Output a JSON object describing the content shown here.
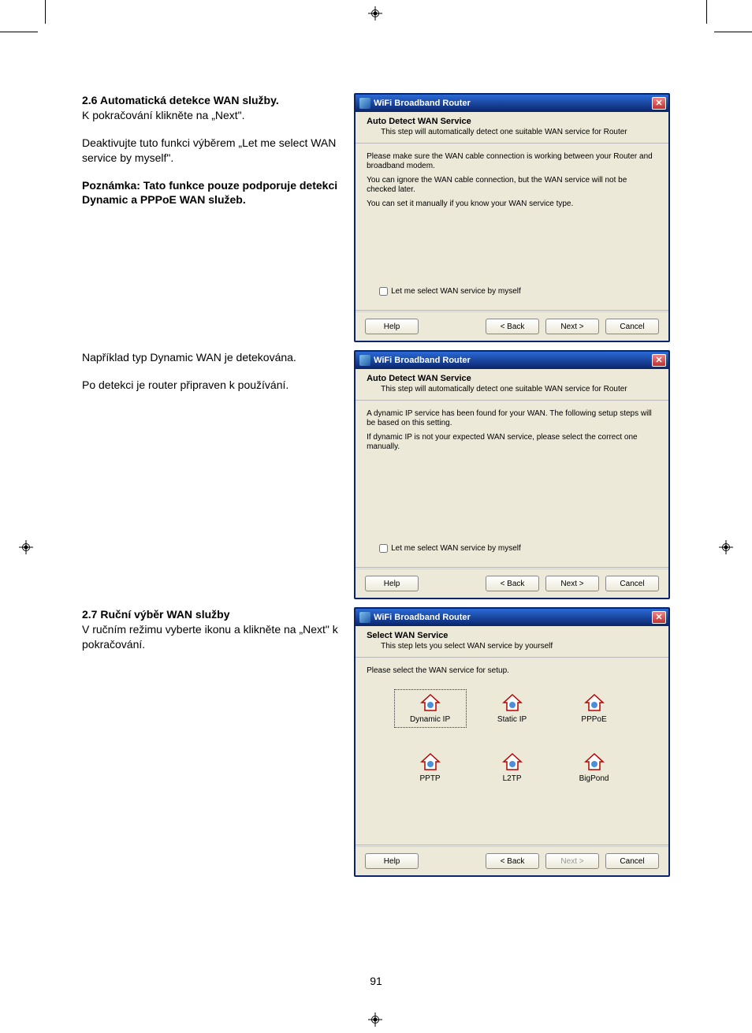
{
  "page_number": "91",
  "section26": {
    "heading": "2.6 Automatická detekce WAN služby.",
    "p1": "K pokračování klikněte na „Next\".",
    "p2": "Deaktivujte tuto funkci výběrem „Let me select WAN service by myself\".",
    "note": "Poznámka: Tato funkce pouze podporuje detekci Dynamic a PPPoE WAN služeb."
  },
  "section26b": {
    "p1": "Například typ Dynamic WAN je detekována.",
    "p2": "Po detekci je router připraven k používání."
  },
  "section27": {
    "heading": "2.7 Ruční výběr WAN služby",
    "p1": "V ručním režimu vyberte ikonu a klikněte na „Next\" k pokračování."
  },
  "dialog1": {
    "title": "WiFi Broadband Router",
    "header_title": "Auto Detect WAN Service",
    "header_sub": "This step will automatically detect one suitable WAN service for Router",
    "body_p1": "Please make sure the WAN cable connection is working between your Router and broadband modem.",
    "body_p2": "You can ignore the WAN cable connection, but the WAN service will not be checked later.",
    "body_p3": "You can set it manually if you know your WAN service type.",
    "checkbox_label": "Let me select WAN service by myself",
    "btn_help": "Help",
    "btn_back": "< Back",
    "btn_next": "Next >",
    "btn_cancel": "Cancel"
  },
  "dialog2": {
    "title": "WiFi Broadband Router",
    "header_title": "Auto Detect WAN Service",
    "header_sub": "This step will automatically detect one suitable WAN service for Router",
    "body_p1": "A dynamic IP service has been found for your WAN. The following setup steps will be based on this setting.",
    "body_p2": "If dynamic IP is not your expected WAN service, please select the correct one manually.",
    "checkbox_label": "Let me select WAN service by myself",
    "btn_help": "Help",
    "btn_back": "< Back",
    "btn_next": "Next >",
    "btn_cancel": "Cancel"
  },
  "dialog3": {
    "title": "WiFi Broadband Router",
    "header_title": "Select WAN Service",
    "header_sub": "This step lets you select WAN service by yourself",
    "body_p1": "Please select the WAN service for setup.",
    "icons": {
      "dynamic": "Dynamic IP",
      "static": "Static IP",
      "pppoe": "PPPoE",
      "pptp": "PPTP",
      "l2tp": "L2TP",
      "bigpond": "BigPond"
    },
    "btn_help": "Help",
    "btn_back": "< Back",
    "btn_next": "Next >",
    "btn_cancel": "Cancel"
  }
}
